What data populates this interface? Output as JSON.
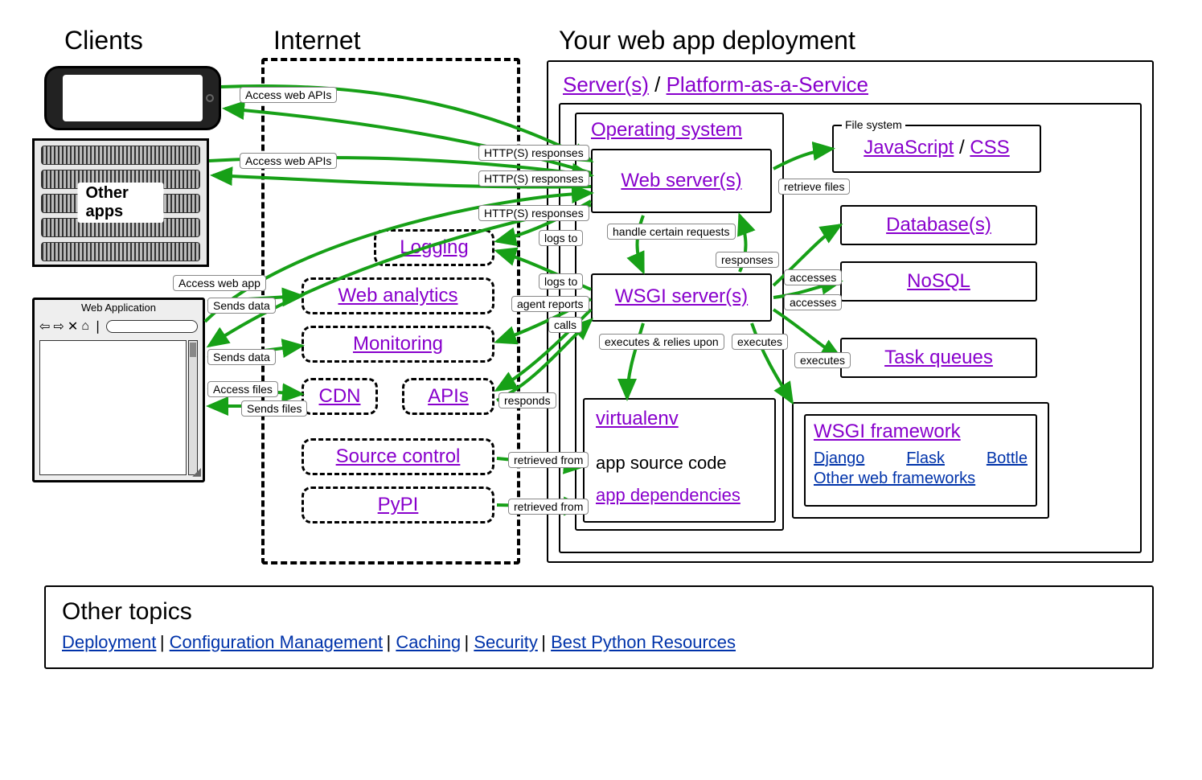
{
  "columns": {
    "clients": "Clients",
    "internet": "Internet",
    "deployment": "Your web app deployment"
  },
  "clients": {
    "other_apps_label": "Other apps",
    "browser_title": "Web Application"
  },
  "deployment": {
    "servers": "Server(s)",
    "slash": " / ",
    "paas": "Platform-as-a-Service",
    "os": "Operating system",
    "web_server": "Web server(s)",
    "wsgi_server": "WSGI server(s)",
    "virtualenv": "virtualenv",
    "app_source": "app source code",
    "app_deps": "app dependencies",
    "file_system_legend": "File system",
    "js": "JavaScript",
    "js_css_slash": " /",
    "css": "CSS",
    "db": "Database(s)",
    "nosql": "NoSQL",
    "tq": "Task queues",
    "wsgi_fw": "WSGI framework",
    "django": "Django",
    "flask": "Flask",
    "bottle": "Bottle",
    "other_fw": "Other web frameworks"
  },
  "internet": {
    "logging": "Logging",
    "analytics": "Web analytics",
    "monitoring": "Monitoring",
    "cdn": "CDN",
    "apis": "APIs",
    "source_control": "Source control",
    "pypi": "PyPI"
  },
  "edges": {
    "access_web_apis1": "Access web APIs",
    "access_web_apis2": "Access web APIs",
    "http_resp1": "HTTP(S) responses",
    "http_resp2": "HTTP(S) responses",
    "http_resp3": "HTTP(S) responses",
    "access_web_app": "Access web app",
    "sends_data1": "Sends data",
    "sends_data2": "Sends data",
    "access_files": "Access files",
    "sends_files": "Sends files",
    "logs_to1": "logs to",
    "logs_to2": "logs to",
    "agent_reports": "agent reports",
    "calls": "calls",
    "responds": "responds",
    "retrieved_from1": "retrieved from",
    "retrieved_from2": "retrieved from",
    "handle_requests": "handle certain requests",
    "responses": "responses",
    "retrieve_files": "retrieve files",
    "accesses1": "accesses",
    "accesses2": "accesses",
    "executes_relies": "executes & relies upon",
    "executes1": "executes",
    "executes2": "executes"
  },
  "other_topics": {
    "heading": "Other topics",
    "deployment": "Deployment",
    "config": "Configuration Management",
    "caching": "Caching",
    "security": "Security",
    "best": "Best Python Resources",
    "sep": " | "
  }
}
